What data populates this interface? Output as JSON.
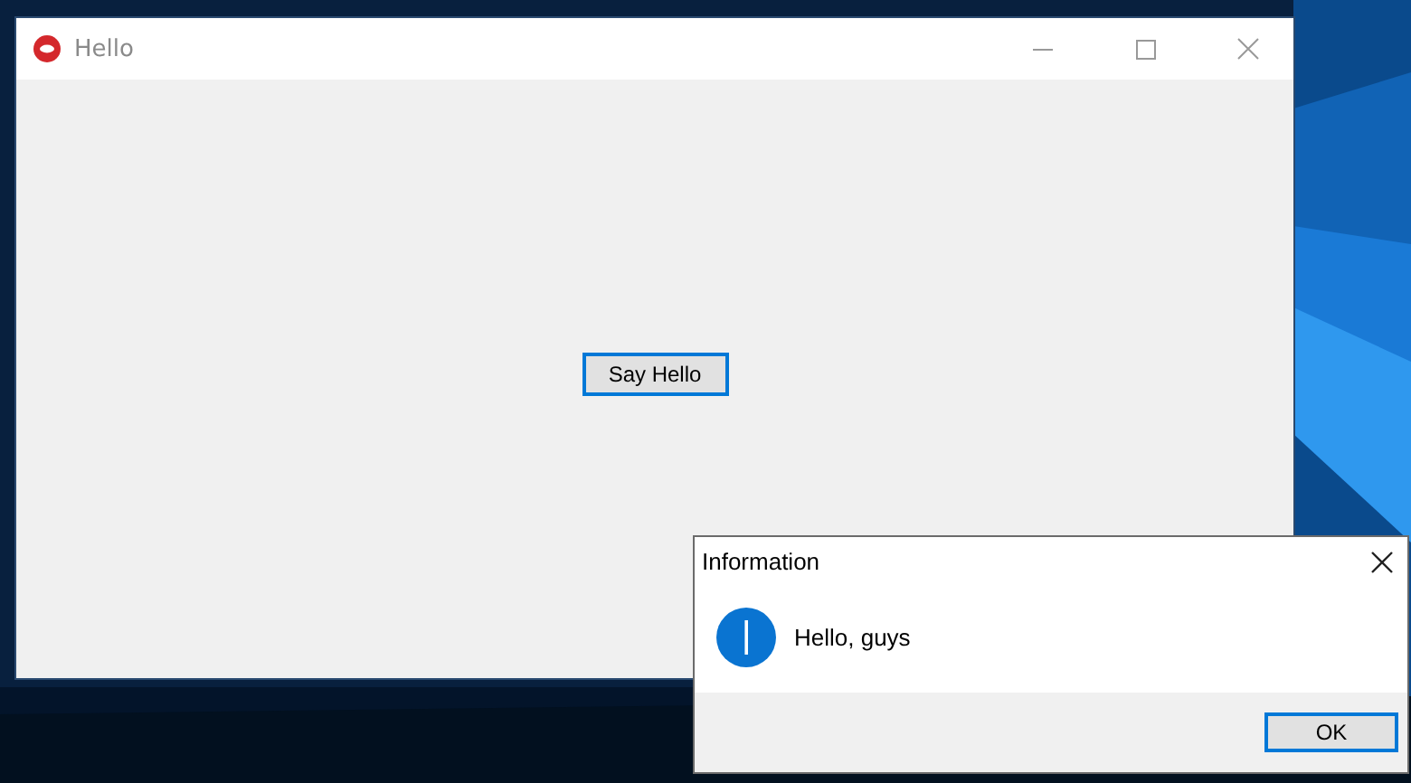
{
  "window": {
    "title": "Hello"
  },
  "main_button": {
    "label": "Say Hello",
    "focused": true
  },
  "dialog": {
    "title": "Information",
    "message": "Hello, guys",
    "buttons": [
      {
        "label": "OK",
        "focused": true
      }
    ]
  }
}
